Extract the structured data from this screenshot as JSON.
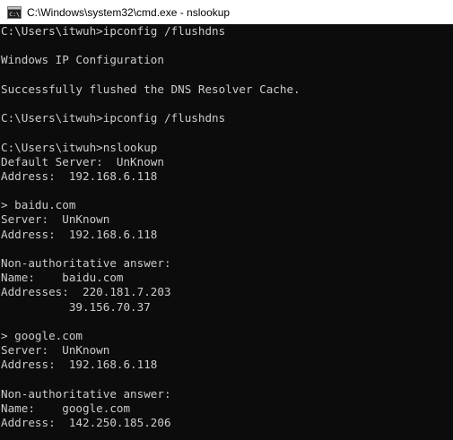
{
  "window": {
    "title": "C:\\Windows\\system32\\cmd.exe - nslookup",
    "icon": "cmd-icon",
    "colors": {
      "console_bg": "#0c0c0c",
      "console_fg": "#cccccc",
      "titlebar_bg": "#ffffff"
    }
  },
  "console": {
    "lines": [
      "C:\\Users\\itwuh>ipconfig /flushdns",
      "",
      "Windows IP Configuration",
      "",
      "Successfully flushed the DNS Resolver Cache.",
      "",
      "C:\\Users\\itwuh>ipconfig /flushdns",
      "",
      "C:\\Users\\itwuh>nslookup",
      "Default Server:  UnKnown",
      "Address:  192.168.6.118",
      "",
      "> baidu.com",
      "Server:  UnKnown",
      "Address:  192.168.6.118",
      "",
      "Non-authoritative answer:",
      "Name:    baidu.com",
      "Addresses:  220.181.7.203",
      "          39.156.70.37",
      "",
      "> google.com",
      "Server:  UnKnown",
      "Address:  192.168.6.118",
      "",
      "Non-authoritative answer:",
      "Name:    google.com",
      "Address:  142.250.185.206",
      ""
    ]
  }
}
